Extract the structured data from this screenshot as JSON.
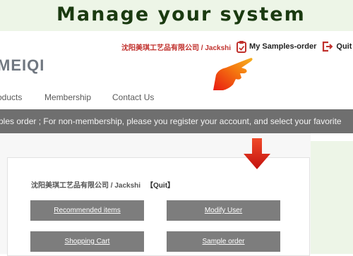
{
  "banner": {
    "title": "Manage your system"
  },
  "topbar": {
    "user_link": "沈阳美琪工艺品有限公司 / Jackshi",
    "samples_order": "My Samples-order",
    "quit": "Quit"
  },
  "logo": "MEIQI",
  "nav": {
    "items": [
      "oducts",
      "Membership",
      "Contact Us"
    ]
  },
  "notice": "ples order ; For non-membership, please you register your account, and select your favorite",
  "panel": {
    "user_label": "沈阳美琪工艺品有限公司 / Jackshi",
    "quit_label": "【Quit】",
    "buttons": [
      "Recommended items",
      "Modify User",
      "Shopping Cart",
      "Sample order"
    ]
  },
  "colors": {
    "banner_bg": "#edf5e7",
    "banner_text": "#1a3a10",
    "user_link": "#c0302c",
    "notice_bg": "#6f6f6f",
    "button_bg": "#7d7d7d",
    "arrow": "#d91f1a"
  },
  "icons": [
    "clipboard-check-icon",
    "exit-icon",
    "pointing-hand-icon",
    "down-arrow-icon"
  ]
}
